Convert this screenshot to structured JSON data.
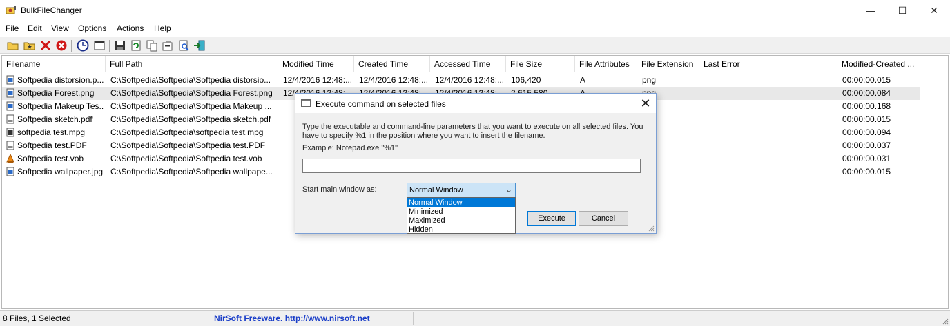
{
  "window": {
    "title": "BulkFileChanger",
    "minimize_glyph": "—",
    "maximize_glyph": "☐",
    "close_glyph": "✕"
  },
  "menu": [
    "File",
    "Edit",
    "View",
    "Options",
    "Actions",
    "Help"
  ],
  "toolbar": {
    "icons": [
      "open-folder-icon",
      "add-files-icon",
      "delete-icon",
      "clear-icon",
      "clock-icon",
      "window-icon",
      "save-icon",
      "refresh-icon",
      "copy-icon",
      "properties-icon",
      "find-icon",
      "exit-icon"
    ]
  },
  "table": {
    "columns": [
      "Filename",
      "Full Path",
      "Modified Time",
      "Created Time",
      "Accessed Time",
      "File Size",
      "File Attributes",
      "File Extension",
      "Last Error",
      "Modified-Created ..."
    ],
    "rows": [
      {
        "icon": "image-file-icon",
        "filename": "Softpedia distorsion.p...",
        "path": "C:\\Softpedia\\Softpedia\\Softpedia distorsio...",
        "modified": "12/4/2016 12:48:...",
        "created": "12/4/2016 12:48:...",
        "accessed": "12/4/2016 12:48:...",
        "size": "106,420",
        "attributes": "A",
        "extension": "png",
        "error": "",
        "diff": "00:00:00.015"
      },
      {
        "icon": "image-file-icon",
        "filename": "Softpedia Forest.png",
        "path": "C:\\Softpedia\\Softpedia\\Softpedia Forest.png",
        "modified": "12/4/2016 12:48:...",
        "created": "12/4/2016 12:48:...",
        "accessed": "12/4/2016 12:48:...",
        "size": "2,615,580",
        "attributes": "A",
        "extension": "png",
        "error": "",
        "diff": "00:00:00.084"
      },
      {
        "icon": "image-file-icon",
        "filename": "Softpedia Makeup Tes...",
        "path": "C:\\Softpedia\\Softpedia\\Softpedia Makeup ...",
        "modified": "",
        "created": "",
        "accessed": "",
        "size": "",
        "attributes": "",
        "extension": "",
        "error": "",
        "diff": "00:00:00.168"
      },
      {
        "icon": "pdf-file-icon",
        "filename": "Softpedia sketch.pdf",
        "path": "C:\\Softpedia\\Softpedia\\Softpedia sketch.pdf",
        "modified": "",
        "created": "",
        "accessed": "",
        "size": "",
        "attributes": "",
        "extension": "",
        "error": "",
        "diff": "00:00:00.015"
      },
      {
        "icon": "video-file-icon",
        "filename": "softpedia test.mpg",
        "path": "C:\\Softpedia\\Softpedia\\softpedia test.mpg",
        "modified": "",
        "created": "",
        "accessed": "",
        "size": "",
        "attributes": "",
        "extension": "",
        "error": "",
        "diff": "00:00:00.094"
      },
      {
        "icon": "pdf-file-icon",
        "filename": "Softpedia test.PDF",
        "path": "C:\\Softpedia\\Softpedia\\Softpedia test.PDF",
        "modified": "",
        "created": "",
        "accessed": "",
        "size": "",
        "attributes": "",
        "extension": "",
        "error": "",
        "diff": "00:00:00.037"
      },
      {
        "icon": "vlc-file-icon",
        "filename": "Softpedia test.vob",
        "path": "C:\\Softpedia\\Softpedia\\Softpedia test.vob",
        "modified": "",
        "created": "",
        "accessed": "",
        "size": "",
        "attributes": "",
        "extension": "",
        "error": "",
        "diff": "00:00:00.031"
      },
      {
        "icon": "image-file-icon",
        "filename": "Softpedia wallpaper.jpg",
        "path": "C:\\Softpedia\\Softpedia\\Softpedia wallpape...",
        "modified": "",
        "created": "",
        "accessed": "",
        "size": "",
        "attributes": "",
        "extension": "",
        "error": "",
        "diff": "00:00:00.015"
      }
    ],
    "selected_row": 1
  },
  "dialog": {
    "title": "Execute command on selected files",
    "close_glyph": "✕",
    "instruction_line1": "Type the executable and command-line parameters that you want to execute on all selected files. You",
    "instruction_line2": "have to specify %1 in the position where you want to insert the filename.",
    "example": "Example: Notepad.exe \"%1\"",
    "command_value": "",
    "start_label": "Start main window as:",
    "start_selected": "Normal Window",
    "start_options": [
      "Normal Window",
      "Minimized",
      "Maximized",
      "Hidden"
    ],
    "execute_label": "Execute",
    "cancel_label": "Cancel"
  },
  "status": {
    "file_count": "8 Files, 1 Selected",
    "freeware_text": "NirSoft Freeware.  http://www.nirsoft.net",
    "freeware_color": "#1a3ec8"
  }
}
